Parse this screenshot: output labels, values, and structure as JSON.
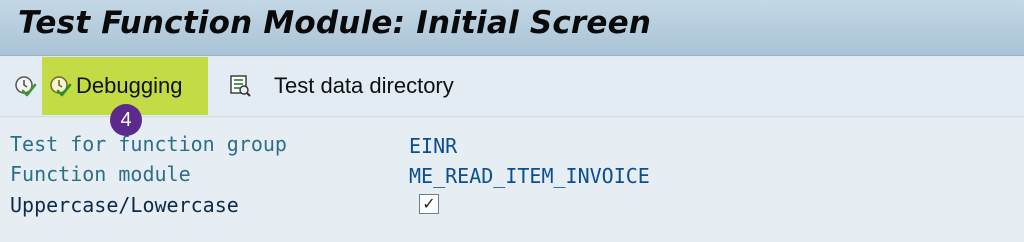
{
  "title": "Test Function Module: Initial Screen",
  "toolbar": {
    "execute_icon": "execute-icon",
    "debugging_label": "Debugging",
    "debugging_icon": "debug-execute-icon",
    "test_data_label": "Test data directory",
    "test_data_icon": "test-data-directory-icon",
    "highlight_color": "#c3db44"
  },
  "annotation": {
    "step_number": "4",
    "color": "#5b2a8c"
  },
  "fields": {
    "function_group_label": "Test for function group",
    "function_group_value": "EINR",
    "function_module_label": "Function module",
    "function_module_value": "ME_READ_ITEM_INVOICE",
    "case_label": "Uppercase/Lowercase",
    "case_checked": true,
    "case_check_glyph": "✓"
  }
}
